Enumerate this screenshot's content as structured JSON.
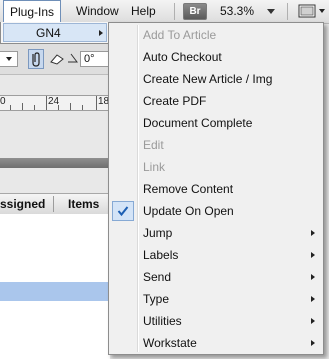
{
  "menubar": {
    "items": [
      {
        "label": "Plug-Ins",
        "active": true
      },
      {
        "label": "Window",
        "active": false
      },
      {
        "label": "Help",
        "active": false
      }
    ],
    "bridge_badge": "Br",
    "zoom_level": "53.3%",
    "view_options_icon": "screen-mode-icon"
  },
  "toolbar": {
    "angle_value": "0°"
  },
  "ruler": {
    "labels": [
      "0",
      "24",
      "18"
    ]
  },
  "panel": {
    "columns": [
      "ssigned",
      "Items"
    ]
  },
  "submenu": {
    "label": "GN4",
    "has_arrow": true
  },
  "dropdown": {
    "items": [
      {
        "label": "Add To Article",
        "disabled": true,
        "checked": false,
        "submenu": false
      },
      {
        "label": "Auto Checkout",
        "disabled": false,
        "checked": false,
        "submenu": false
      },
      {
        "label": "Create New Article / Img",
        "disabled": false,
        "checked": false,
        "submenu": false
      },
      {
        "label": "Create PDF",
        "disabled": false,
        "checked": false,
        "submenu": false
      },
      {
        "label": "Document Complete",
        "disabled": false,
        "checked": false,
        "submenu": false
      },
      {
        "label": "Edit",
        "disabled": true,
        "checked": false,
        "submenu": false
      },
      {
        "label": "Link",
        "disabled": true,
        "checked": false,
        "submenu": false
      },
      {
        "label": "Remove Content",
        "disabled": false,
        "checked": false,
        "submenu": false
      },
      {
        "label": "Update On Open",
        "disabled": false,
        "checked": true,
        "submenu": false
      },
      {
        "label": "Jump",
        "disabled": false,
        "checked": false,
        "submenu": true
      },
      {
        "label": "Labels",
        "disabled": false,
        "checked": false,
        "submenu": true
      },
      {
        "label": "Send",
        "disabled": false,
        "checked": false,
        "submenu": true
      },
      {
        "label": "Type",
        "disabled": false,
        "checked": false,
        "submenu": true
      },
      {
        "label": "Utilities",
        "disabled": false,
        "checked": false,
        "submenu": true
      },
      {
        "label": "Workstate",
        "disabled": false,
        "checked": false,
        "submenu": true
      }
    ]
  },
  "colors": {
    "highlight": "#d8e6f6",
    "selection_row": "#aac6ec",
    "check": "#1d5fb3"
  }
}
